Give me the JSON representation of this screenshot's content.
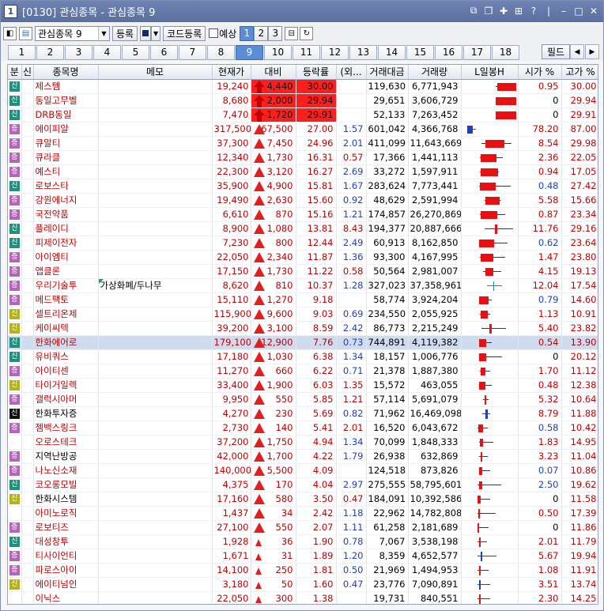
{
  "window": {
    "title_icon": "1",
    "title": "[0130] 관심종목 - 관심종목 9"
  },
  "toolbar": {
    "group_selected": "관심종목 9",
    "register_label": "등록",
    "code_register_label": "코드등록",
    "forecast_label": "예상",
    "pages": [
      "1",
      "2",
      "3"
    ],
    "active_page": "1"
  },
  "tabs": {
    "items": [
      "1",
      "2",
      "3",
      "4",
      "5",
      "6",
      "7",
      "8",
      "9",
      "10",
      "11",
      "12",
      "13",
      "14",
      "15",
      "16",
      "17",
      "18"
    ],
    "active": "9",
    "field_label": "필드"
  },
  "columns": [
    "분",
    "신",
    "종목명",
    "메모",
    "현재가",
    "대비",
    "등락률",
    "(외...",
    "거래대금",
    "거래량",
    "L일봉H",
    "시가 %",
    "고가 %"
  ],
  "colors": {
    "up": "#c00000",
    "down": "#1f3fbf",
    "highlight": "#ff1e1e",
    "selected_row": "#cfdcef"
  },
  "rows": [
    {
      "badge": "신",
      "bc": "t",
      "name": "제스템",
      "memo": "",
      "price": "19,240",
      "diff": "4,440",
      "dir": "arrow",
      "rate": "30.00",
      "hot": true,
      "ext": "",
      "amount": "119,630",
      "volume": "6,771,943",
      "open": "0.95",
      "open_c": "red",
      "high": "30.00",
      "candle": {
        "lo": 0.6,
        "hi": 0.96,
        "o": 0.62,
        "c": 0.96
      }
    },
    {
      "badge": "신",
      "bc": "t",
      "name": "동일고무벨",
      "memo": "",
      "price": "8,680",
      "diff": "2,000",
      "dir": "arrow",
      "rate": "29.94",
      "hot": true,
      "ext": "",
      "amount": "29,651",
      "volume": "3,606,729",
      "open": "0",
      "open_c": "blk",
      "high": "29.94",
      "candle": {
        "lo": 0.6,
        "hi": 0.96,
        "o": 0.6,
        "c": 0.96
      }
    },
    {
      "badge": "신",
      "bc": "t",
      "name": "DRB동일",
      "memo": "",
      "price": "7,470",
      "diff": "1,720",
      "dir": "arrow",
      "rate": "29.91",
      "hot": true,
      "ext": "",
      "amount": "52,133",
      "volume": "7,263,452",
      "open": "0",
      "open_c": "blk",
      "high": "29.91",
      "candle": {
        "lo": 0.6,
        "hi": 0.96,
        "o": 0.6,
        "c": 0.96
      }
    },
    {
      "badge": "증",
      "bc": "p",
      "name": "에이피알",
      "memo": "",
      "price": "317,500",
      "diff": "67,500",
      "dir": "tri",
      "rate": "27.00",
      "ext": "1.57",
      "ext_c": "blue",
      "amount": "601,042",
      "volume": "4,366,768",
      "open": "78.20",
      "open_c": "red",
      "high": "87.00",
      "candle": {
        "lo": 0.1,
        "hi": 0.25,
        "o": 0.1,
        "c": 0.2,
        "blue": true
      }
    },
    {
      "badge": "증",
      "bc": "p",
      "name": "큐알티",
      "memo": "",
      "price": "37,300",
      "diff": "7,450",
      "dir": "tri",
      "rate": "24.96",
      "ext": "2.01",
      "ext_c": "blue",
      "amount": "411,099",
      "volume": "11,643,669",
      "open": "8.54",
      "open_c": "red",
      "high": "29.98",
      "candle": {
        "lo": 0.35,
        "hi": 0.88,
        "o": 0.42,
        "c": 0.75
      }
    },
    {
      "badge": "증",
      "bc": "p",
      "name": "큐라클",
      "memo": "",
      "price": "12,340",
      "diff": "1,730",
      "dir": "tri",
      "rate": "16.31",
      "ext": "0.57",
      "ext_c": "red",
      "amount": "17,366",
      "volume": "1,441,113",
      "open": "2.36",
      "open_c": "red",
      "high": "22.05",
      "candle": {
        "lo": 0.32,
        "hi": 0.72,
        "o": 0.34,
        "c": 0.62
      }
    },
    {
      "badge": "증",
      "bc": "p",
      "name": "예스티",
      "memo": "",
      "price": "22,300",
      "diff": "3,120",
      "dir": "tri",
      "rate": "16.27",
      "ext": "2.69",
      "ext_c": "blue",
      "amount": "33,272",
      "volume": "1,597,911",
      "open": "0.94",
      "open_c": "red",
      "high": "17.05",
      "candle": {
        "lo": 0.32,
        "hi": 0.66,
        "o": 0.33,
        "c": 0.63
      }
    },
    {
      "badge": "신",
      "bc": "t",
      "name": "로보스타",
      "memo": "",
      "price": "35,900",
      "diff": "4,900",
      "dir": "tri",
      "rate": "15.81",
      "ext": "1.67",
      "ext_c": "blue",
      "amount": "283,624",
      "volume": "7,773,441",
      "open": "0.48",
      "open_c": "blue",
      "high": "27.42",
      "candle": {
        "lo": 0.3,
        "hi": 0.85,
        "o": 0.32,
        "c": 0.6
      }
    },
    {
      "badge": "증",
      "bc": "p",
      "name": "강원에너지",
      "memo": "",
      "price": "19,490",
      "diff": "2,630",
      "dir": "tri",
      "rate": "15.60",
      "ext": "0.92",
      "ext_c": "blue",
      "amount": "48,629",
      "volume": "2,591,994",
      "open": "5.58",
      "open_c": "red",
      "high": "15.66",
      "candle": {
        "lo": 0.4,
        "hi": 0.68,
        "o": 0.42,
        "c": 0.67
      }
    },
    {
      "badge": "증",
      "bc": "p",
      "name": "국전약품",
      "memo": "",
      "price": "6,610",
      "diff": "870",
      "dir": "tri",
      "rate": "15.16",
      "ext": "1.21",
      "ext_c": "blue",
      "amount": "174,857",
      "volume": "26,270,869",
      "open": "0.87",
      "open_c": "red",
      "high": "23.34",
      "candle": {
        "lo": 0.32,
        "hi": 0.76,
        "o": 0.33,
        "c": 0.62
      }
    },
    {
      "badge": "신",
      "bc": "t",
      "name": "플레이디",
      "memo": "",
      "price": "8,900",
      "diff": "1,080",
      "dir": "tri",
      "rate": "13.81",
      "ext": "8.43",
      "ext_c": "red",
      "amount": "194,377",
      "volume": "20,887,666",
      "open": "11.76",
      "open_c": "red",
      "high": "29.16",
      "candle": {
        "lo": 0.4,
        "hi": 0.9,
        "o": 0.58,
        "c": 0.62
      }
    },
    {
      "badge": "신",
      "bc": "t",
      "name": "피제이전자",
      "memo": "",
      "price": "7,230",
      "diff": "800",
      "dir": "tri",
      "rate": "12.44",
      "ext": "2.49",
      "ext_c": "blue",
      "amount": "60,913",
      "volume": "8,162,850",
      "open": "0.62",
      "open_c": "blue",
      "high": "23.64",
      "candle": {
        "lo": 0.3,
        "hi": 0.8,
        "o": 0.31,
        "c": 0.58
      }
    },
    {
      "badge": "증",
      "bc": "p",
      "name": "아이엠티",
      "memo": "",
      "price": "22,050",
      "diff": "2,340",
      "dir": "tri",
      "rate": "11.87",
      "ext": "1.36",
      "ext_c": "blue",
      "amount": "93,300",
      "volume": "4,167,995",
      "open": "1.47",
      "open_c": "red",
      "high": "23.80",
      "candle": {
        "lo": 0.32,
        "hi": 0.76,
        "o": 0.34,
        "c": 0.56
      }
    },
    {
      "badge": "증",
      "bc": "p",
      "name": "앱클론",
      "memo": "",
      "price": "17,150",
      "diff": "1,730",
      "dir": "tri",
      "rate": "11.22",
      "ext": "0.58",
      "ext_c": "red",
      "amount": "50,564",
      "volume": "2,981,007",
      "open": "4.15",
      "open_c": "red",
      "high": "19.13",
      "candle": {
        "lo": 0.38,
        "hi": 0.7,
        "o": 0.42,
        "c": 0.56
      }
    },
    {
      "badge": "증",
      "bc": "p",
      "name": "우리기술투",
      "memo": "가상화폐/두나무",
      "price": "8,620",
      "diff": "810",
      "dir": "tri",
      "rate": "10.37",
      "ext": "1.28",
      "ext_c": "blue",
      "amount": "327,023",
      "volume": "37,358,961",
      "open": "12.04",
      "open_c": "red",
      "high": "17.54",
      "candle": {
        "lo": 0.45,
        "hi": 0.72,
        "o": 0.55,
        "c": 0.57,
        "green": true
      }
    },
    {
      "badge": "증",
      "bc": "p",
      "name": "메드팩토",
      "memo": "",
      "price": "15,110",
      "diff": "1,270",
      "dir": "tri",
      "rate": "9.18",
      "ext": "",
      "amount": "58,774",
      "volume": "3,924,204",
      "open": "0.79",
      "open_c": "blue",
      "high": "14.60",
      "candle": {
        "lo": 0.3,
        "hi": 0.52,
        "o": 0.31,
        "c": 0.48
      }
    },
    {
      "badge": "신",
      "bc": "y",
      "name": "셀트리온제",
      "memo": "",
      "price": "115,900",
      "diff": "9,600",
      "dir": "tri",
      "rate": "9.03",
      "ext": "0.69",
      "ext_c": "blue",
      "amount": "234,550",
      "volume": "2,055,925",
      "open": "1.13",
      "open_c": "red",
      "high": "10.91",
      "candle": {
        "lo": 0.32,
        "hi": 0.5,
        "o": 0.33,
        "c": 0.46
      }
    },
    {
      "badge": "신",
      "bc": "y",
      "name": "케이씨텍",
      "memo": "",
      "price": "39,200",
      "diff": "3,100",
      "dir": "tri",
      "rate": "8.59",
      "ext": "2.42",
      "ext_c": "blue",
      "amount": "86,773",
      "volume": "2,215,249",
      "open": "5.40",
      "open_c": "red",
      "high": "23.82",
      "candle": {
        "lo": 0.35,
        "hi": 0.78,
        "o": 0.48,
        "c": 0.52
      }
    },
    {
      "badge": "신",
      "bc": "t",
      "name": "한화에어로",
      "memo": "",
      "price": "179,100",
      "diff": "12,900",
      "dir": "tri",
      "rate": "7.76",
      "ext": "0.73",
      "ext_c": "blue",
      "amount": "744,891",
      "volume": "4,119,382",
      "open": "0.54",
      "open_c": "red",
      "high": "13.90",
      "candle": {
        "lo": 0.3,
        "hi": 0.52,
        "o": 0.31,
        "c": 0.44
      },
      "selected": true
    },
    {
      "badge": "신",
      "bc": "t",
      "name": "유비쿼스",
      "memo": "",
      "price": "17,180",
      "diff": "1,030",
      "dir": "tri",
      "rate": "6.38",
      "ext": "1.34",
      "ext_c": "blue",
      "amount": "18,157",
      "volume": "1,006,776",
      "open": "0",
      "open_c": "blk",
      "high": "20.12",
      "candle": {
        "lo": 0.3,
        "hi": 0.7,
        "o": 0.3,
        "c": 0.42
      }
    },
    {
      "badge": "증",
      "bc": "p",
      "name": "아이티센",
      "memo": "",
      "price": "11,270",
      "diff": "660",
      "dir": "tri",
      "rate": "6.22",
      "ext": "0.71",
      "ext_c": "blue",
      "amount": "21,378",
      "volume": "1,887,380",
      "open": "1.70",
      "open_c": "red",
      "high": "11.12",
      "candle": {
        "lo": 0.32,
        "hi": 0.5,
        "o": 0.34,
        "c": 0.42
      }
    },
    {
      "badge": "신",
      "bc": "y",
      "name": "타이거일렉",
      "memo": "",
      "price": "33,400",
      "diff": "1,900",
      "dir": "tri",
      "rate": "6.03",
      "ext": "1.35",
      "ext_c": "red",
      "amount": "15,572",
      "volume": "463,055",
      "open": "0.48",
      "open_c": "red",
      "high": "12.38",
      "candle": {
        "lo": 0.3,
        "hi": 0.52,
        "o": 0.31,
        "c": 0.42
      }
    },
    {
      "badge": "증",
      "bc": "p",
      "name": "갤럭시아머",
      "memo": "",
      "price": "9,950",
      "diff": "550",
      "dir": "tri",
      "rate": "5.85",
      "ext": "1.21",
      "ext_c": "red",
      "amount": "57,114",
      "volume": "5,691,079",
      "open": "5.32",
      "open_c": "red",
      "high": "10.64",
      "candle": {
        "lo": 0.38,
        "hi": 0.48,
        "o": 0.4,
        "c": 0.42
      }
    },
    {
      "badge": "신",
      "bc": "k",
      "name": "한화투자증",
      "memo": "",
      "price": "4,270",
      "diff": "230",
      "dir": "tri",
      "rate": "5.69",
      "ext": "0.82",
      "ext_c": "blue",
      "amount": "71,962",
      "volume": "16,469,098",
      "open": "8.79",
      "open_c": "red",
      "high": "11.88",
      "candle": {
        "lo": 0.36,
        "hi": 0.5,
        "o": 0.42,
        "c": 0.46,
        "blue": true
      },
      "name_c": "blk"
    },
    {
      "badge": "증",
      "bc": "p",
      "name": "젬백스링크",
      "memo": "",
      "price": "2,730",
      "diff": "140",
      "dir": "tri",
      "rate": "5.41",
      "ext": "2.01",
      "ext_c": "red",
      "amount": "16,520",
      "volume": "6,043,672",
      "open": "0.58",
      "open_c": "blue",
      "high": "10.42",
      "candle": {
        "lo": 0.28,
        "hi": 0.46,
        "o": 0.29,
        "c": 0.38
      }
    },
    {
      "badge": "",
      "bc": "",
      "name": "오로스테크",
      "memo": "",
      "price": "37,200",
      "diff": "1,750",
      "dir": "tri",
      "rate": "4.94",
      "ext": "1.34",
      "ext_c": "blue",
      "amount": "70,099",
      "volume": "1,848,333",
      "open": "1.83",
      "open_c": "red",
      "high": "14.95",
      "candle": {
        "lo": 0.3,
        "hi": 0.55,
        "o": 0.32,
        "c": 0.38
      }
    },
    {
      "badge": "증",
      "bc": "p",
      "name": "지역난방공",
      "memo": "",
      "price": "42,000",
      "diff": "1,700",
      "dir": "tri",
      "rate": "4.22",
      "ext": "1.79",
      "ext_c": "blue",
      "amount": "26,938",
      "volume": "632,869",
      "open": "3.23",
      "open_c": "red",
      "high": "11.04",
      "candle": {
        "lo": 0.3,
        "hi": 0.45,
        "o": 0.34,
        "c": 0.36
      },
      "name_c": "blk"
    },
    {
      "badge": "증",
      "bc": "p",
      "name": "나노신소재",
      "memo": "",
      "price": "140,000",
      "diff": "5,500",
      "dir": "tri",
      "rate": "4.09",
      "ext": "",
      "amount": "124,518",
      "volume": "873,826",
      "open": "0.07",
      "open_c": "blue",
      "high": "10.86",
      "candle": {
        "lo": 0.3,
        "hi": 0.5,
        "o": 0.3,
        "c": 0.36
      }
    },
    {
      "badge": "신",
      "bc": "t",
      "name": "코오롱모빌",
      "memo": "",
      "price": "4,375",
      "diff": "170",
      "dir": "tri",
      "rate": "4.04",
      "ext": "2.97",
      "ext_c": "blue",
      "amount": "275,555",
      "volume": "58,795,601",
      "open": "2.50",
      "open_c": "blue",
      "high": "19.62",
      "candle": {
        "lo": 0.28,
        "hi": 0.7,
        "o": 0.3,
        "c": 0.36
      }
    },
    {
      "badge": "신",
      "bc": "y",
      "name": "한화시스템",
      "memo": "",
      "price": "17,160",
      "diff": "580",
      "dir": "tri",
      "rate": "3.50",
      "ext": "0.47",
      "ext_c": "red",
      "amount": "184,091",
      "volume": "10,392,586",
      "open": "0",
      "open_c": "blk",
      "high": "11.58",
      "candle": {
        "lo": 0.28,
        "hi": 0.5,
        "o": 0.28,
        "c": 0.33
      },
      "name_c": "blk"
    },
    {
      "badge": "",
      "bc": "",
      "name": "아미노로직",
      "memo": "",
      "price": "1,437",
      "diff": "34",
      "dir": "tri",
      "rate": "2.42",
      "ext": "1.18",
      "ext_c": "blue",
      "amount": "22,962",
      "volume": "14,782,808",
      "open": "0.50",
      "open_c": "red",
      "high": "17.39",
      "candle": {
        "lo": 0.28,
        "hi": 0.6,
        "o": 0.29,
        "c": 0.32
      }
    },
    {
      "badge": "증",
      "bc": "p",
      "name": "로보티즈",
      "memo": "",
      "price": "27,100",
      "diff": "550",
      "dir": "tri",
      "rate": "2.07",
      "ext": "1.11",
      "ext_c": "blue",
      "amount": "61,258",
      "volume": "2,181,689",
      "open": "0",
      "open_c": "blk",
      "high": "11.86",
      "candle": {
        "lo": 0.28,
        "hi": 0.48,
        "o": 0.28,
        "c": 0.31
      }
    },
    {
      "badge": "신",
      "bc": "t",
      "name": "대성창투",
      "memo": "",
      "price": "1,928",
      "diff": "36",
      "dir": "tri-sm",
      "rate": "1.90",
      "ext": "0.78",
      "ext_c": "blue",
      "amount": "7,067",
      "volume": "3,538,198",
      "open": "2.01",
      "open_c": "red",
      "high": "11.79",
      "candle": {
        "lo": 0.28,
        "hi": 0.44,
        "o": 0.31,
        "c": 0.32
      }
    },
    {
      "badge": "증",
      "bc": "p",
      "name": "티사이언티",
      "memo": "",
      "price": "1,671",
      "diff": "31",
      "dir": "tri-sm",
      "rate": "1.89",
      "ext": "1.20",
      "ext_c": "blue",
      "amount": "8,359",
      "volume": "4,652,577",
      "open": "5.67",
      "open_c": "red",
      "high": "19.94",
      "candle": {
        "lo": 0.28,
        "hi": 0.62,
        "o": 0.34,
        "c": 0.37,
        "blue": true
      }
    },
    {
      "badge": "증",
      "bc": "p",
      "name": "파로스아이",
      "memo": "",
      "price": "14,100",
      "diff": "250",
      "dir": "tri-sm",
      "rate": "1.81",
      "ext": "0.50",
      "ext_c": "blue",
      "amount": "21,969",
      "volume": "1,494,953",
      "open": "1.08",
      "open_c": "red",
      "high": "11.91",
      "candle": {
        "lo": 0.28,
        "hi": 0.48,
        "o": 0.3,
        "c": 0.31
      }
    },
    {
      "badge": "신",
      "bc": "y",
      "name": "에이티넘인",
      "memo": "",
      "price": "3,180",
      "diff": "50",
      "dir": "tri-sm",
      "rate": "1.60",
      "ext": "0.47",
      "ext_c": "blue",
      "amount": "23,776",
      "volume": "7,090,891",
      "open": "3.51",
      "open_c": "red",
      "high": "13.74",
      "candle": {
        "lo": 0.28,
        "hi": 0.5,
        "o": 0.3,
        "c": 0.32,
        "blue": true
      }
    },
    {
      "badge": "",
      "bc": "",
      "name": "이닉스",
      "memo": "",
      "price": "22,050",
      "diff": "300",
      "dir": "tri-sm",
      "rate": "1.38",
      "ext": "",
      "amount": "19,731",
      "volume": "840,551",
      "open": "2.30",
      "open_c": "red",
      "high": "14.25",
      "candle": {
        "lo": 0.28,
        "hi": 0.5,
        "o": 0.3,
        "c": 0.32
      }
    }
  ]
}
